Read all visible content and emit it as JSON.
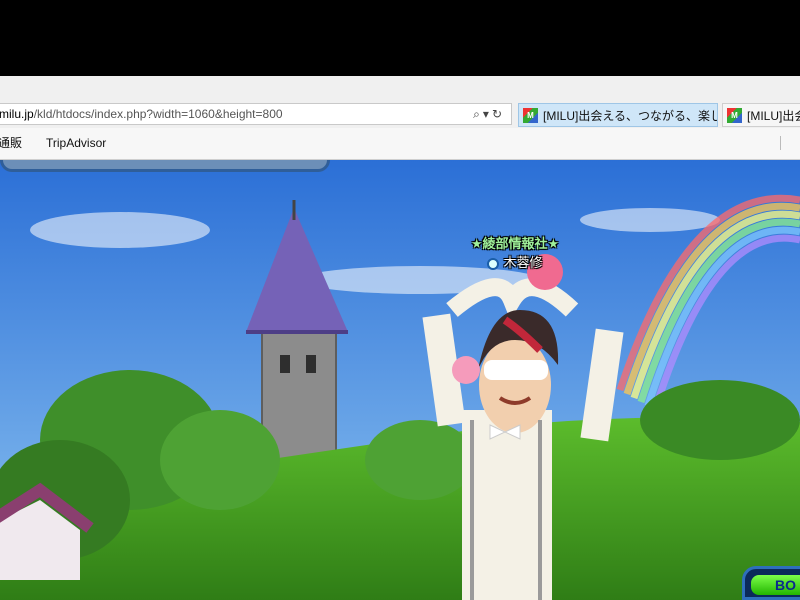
{
  "browser": {
    "address": {
      "domain": "milu.jp",
      "path": "/kld/htdocs/index.php?width=1060&height=800",
      "icons": [
        "search-icon",
        "dropdown-icon",
        "refresh-icon"
      ]
    },
    "tabs": [
      {
        "label": "[MILU]出会える、つながる、楽しめ...",
        "active": true
      },
      {
        "label": "[MILU]出会",
        "active": false
      }
    ],
    "favorites": [
      {
        "label": "通販"
      },
      {
        "label": "TripAdvisor"
      }
    ]
  },
  "game": {
    "character": {
      "guild_name": "★綾部情報社★",
      "player_name": "木蓉修"
    },
    "bottom_button_label": "BO"
  },
  "colors": {
    "sky_top": "#2b6fd6",
    "sky_bottom": "#8fc6f2",
    "grass": "#49a324",
    "guild_text": "#9ff09a"
  }
}
